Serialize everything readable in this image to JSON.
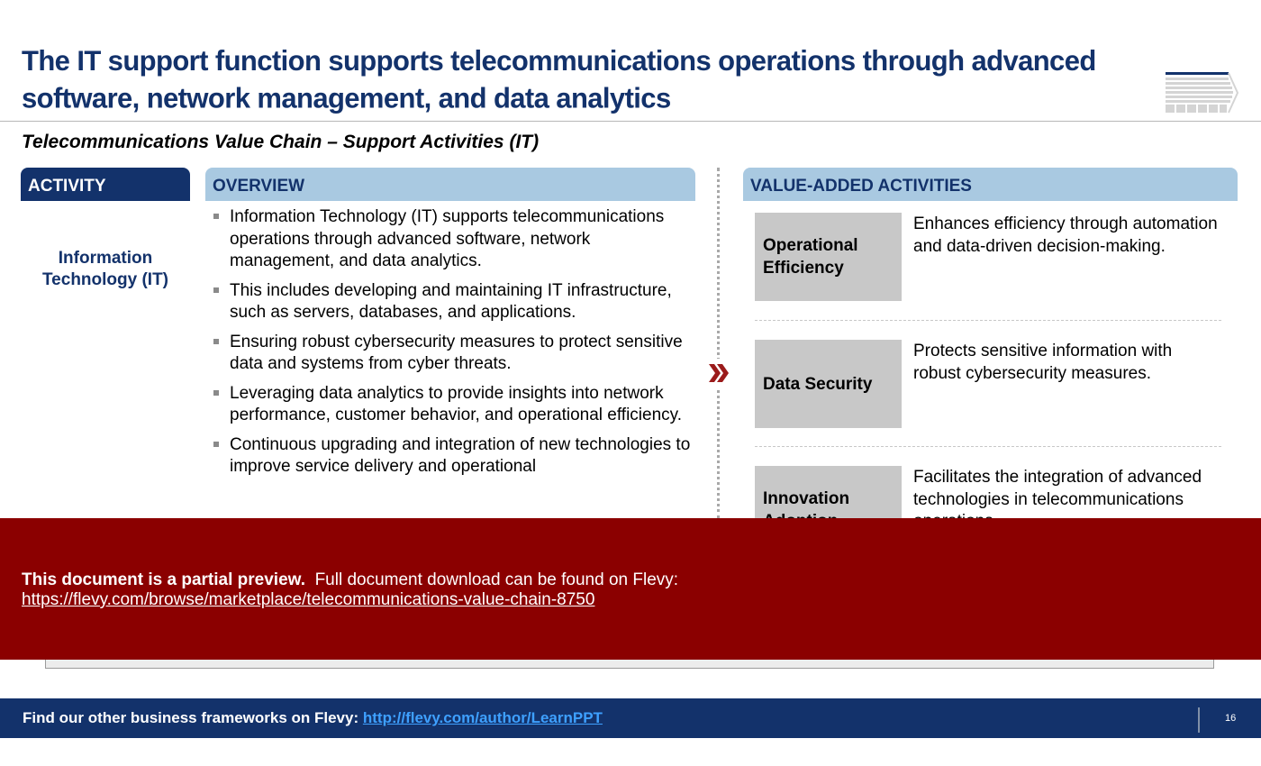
{
  "header": {
    "title": "The IT support function supports telecommunications operations through advanced software, network management, and data analytics",
    "subtitle": "Telecommunications Value Chain – Support Activities (IT)",
    "logo_icon": "value-chain-logo-icon"
  },
  "columns": {
    "activity": "ACTIVITY",
    "overview": "OVERVIEW",
    "value_added": "VALUE-ADDED ACTIVITIES"
  },
  "activity_name": "Information Technology (IT)",
  "overview_items": [
    "Information Technology (IT) supports telecommunications operations through advanced software, network management, and data analytics.",
    "This includes developing and maintaining IT infrastructure, such as servers, databases, and applications.",
    "Ensuring robust cybersecurity measures to protect sensitive data and systems from cyber threats.",
    "Leveraging data analytics to provide insights into network performance, customer behavior, and operational efficiency.",
    "Continuous upgrading and integration of new technologies to improve service delivery and operational"
  ],
  "value_added_activities": [
    {
      "label": "Operational Efficiency",
      "description": "Enhances efficiency through automation and data-driven decision-making."
    },
    {
      "label": "Data Security",
      "description": "Protects sensitive information with robust cybersecurity measures."
    },
    {
      "label": "Innovation Adoption",
      "description": "Facilitates the integration of advanced technologies in telecommunications operations."
    }
  ],
  "arrow_icon": "double-chevron-right-icon",
  "preview_banner": {
    "bold_text": "This document is a partial preview.",
    "text": "Full document download can be found on Flevy:",
    "link": "https://flevy.com/browse/marketplace/telecommunications-value-chain-8750"
  },
  "footer": {
    "text": "Find our other business frameworks on Flevy:",
    "link": "http://flevy.com/author/LearnPPT",
    "page_number": "16"
  },
  "colors": {
    "navy": "#13326b",
    "light_blue": "#a9c9e1",
    "banner_red": "#8b0000",
    "box_gray": "#c8c8c8",
    "link_blue": "#3ea0ff"
  }
}
